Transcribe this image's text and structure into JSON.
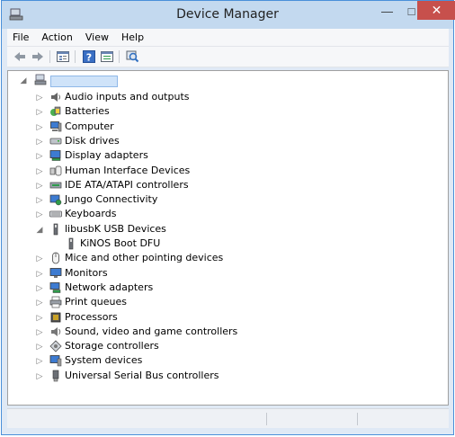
{
  "window": {
    "title": "Device Manager",
    "minimize_glyph": "—",
    "maximize_glyph": "□",
    "close_glyph": "✕"
  },
  "menu": [
    "File",
    "Action",
    "View",
    "Help"
  ],
  "toolbar": {
    "icons": [
      "back-arrow-icon",
      "forward-arrow-icon",
      "properties-icon",
      "help-icon",
      "device-list-icon",
      "scan-hardware-icon"
    ]
  },
  "colors": {
    "accent": "#4a90d9",
    "close": "#c7504c",
    "selection": "#cfe3f9"
  },
  "tree": {
    "root_label": "",
    "items": [
      {
        "label": "Audio inputs and outputs",
        "icon": "speaker-icon",
        "expanded": false
      },
      {
        "label": "Batteries",
        "icon": "battery-icon",
        "expanded": false
      },
      {
        "label": "Computer",
        "icon": "computer-icon",
        "expanded": false
      },
      {
        "label": "Disk drives",
        "icon": "disk-drive-icon",
        "expanded": false
      },
      {
        "label": "Display adapters",
        "icon": "display-adapter-icon",
        "expanded": false
      },
      {
        "label": "Human Interface Devices",
        "icon": "hid-icon",
        "expanded": false
      },
      {
        "label": "IDE ATA/ATAPI controllers",
        "icon": "ide-controller-icon",
        "expanded": false
      },
      {
        "label": "Jungo Connectivity",
        "icon": "jungo-icon",
        "expanded": false
      },
      {
        "label": "Keyboards",
        "icon": "keyboard-icon",
        "expanded": false
      },
      {
        "label": "libusbK USB Devices",
        "icon": "usb-device-icon",
        "expanded": true,
        "children": [
          {
            "label": "KiNOS Boot DFU",
            "icon": "usb-device-icon"
          }
        ]
      },
      {
        "label": "Mice and other pointing devices",
        "icon": "mouse-icon",
        "expanded": false
      },
      {
        "label": "Monitors",
        "icon": "monitor-icon",
        "expanded": false
      },
      {
        "label": "Network adapters",
        "icon": "network-adapter-icon",
        "expanded": false
      },
      {
        "label": "Print queues",
        "icon": "printer-icon",
        "expanded": false
      },
      {
        "label": "Processors",
        "icon": "processor-icon",
        "expanded": false
      },
      {
        "label": "Sound, video and game controllers",
        "icon": "sound-icon",
        "expanded": false
      },
      {
        "label": "Storage controllers",
        "icon": "storage-icon",
        "expanded": false
      },
      {
        "label": "System devices",
        "icon": "system-devices-icon",
        "expanded": false
      },
      {
        "label": "Universal Serial Bus controllers",
        "icon": "usb-controller-icon",
        "expanded": false
      }
    ]
  }
}
